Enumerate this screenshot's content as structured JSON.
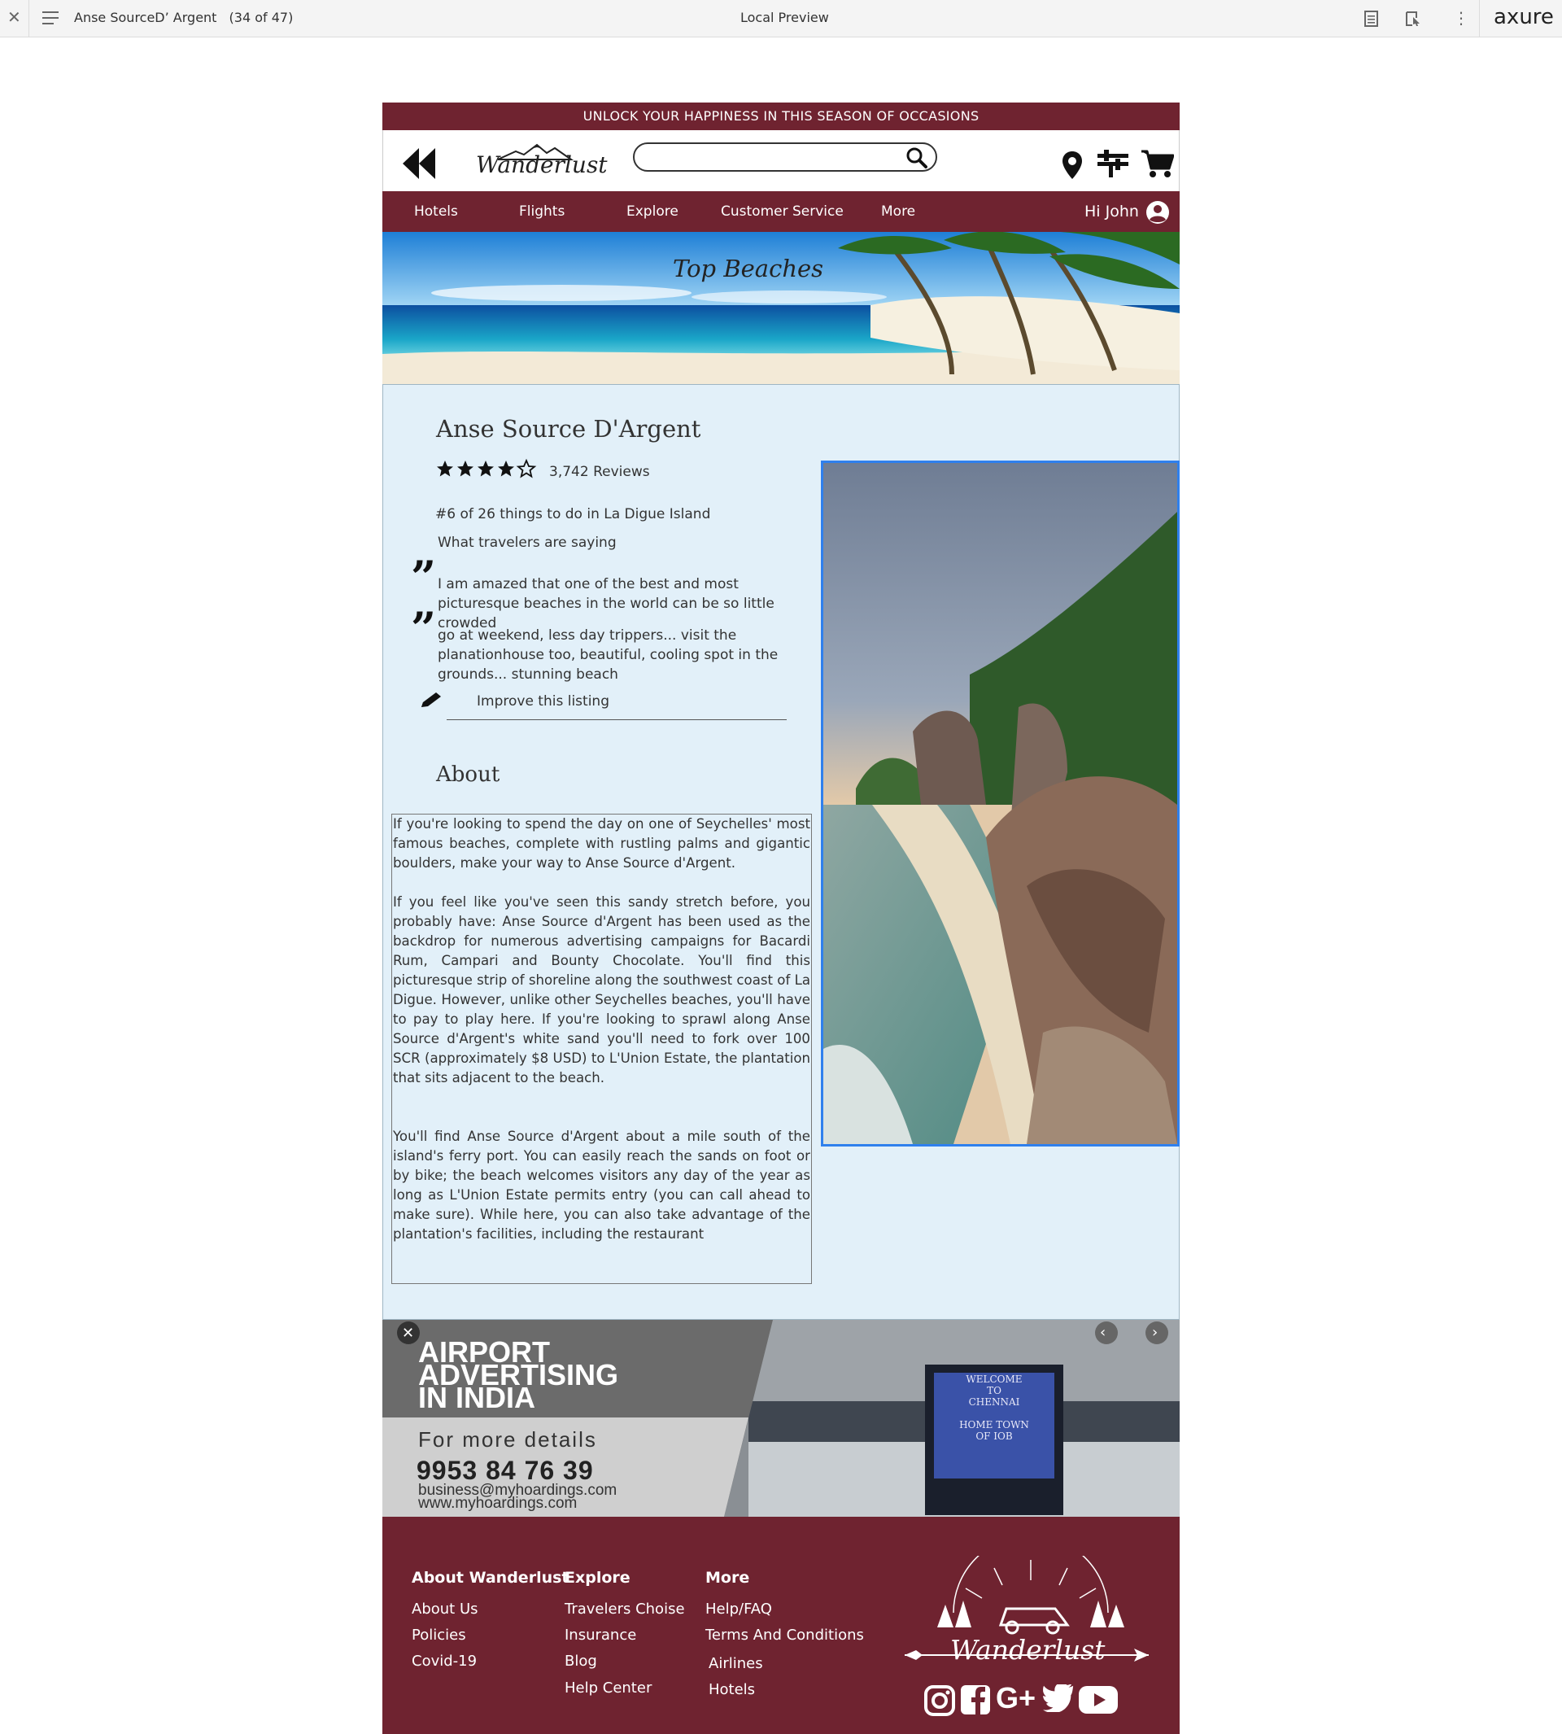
{
  "toolbar": {
    "page_name": "Anse SourceD’ Argent",
    "page_count": "(34 of 47)",
    "center_title": "Local Preview",
    "brand": "axure"
  },
  "promo": {
    "text": "UNLOCK YOUR HAPPINESS IN THIS SEASON OF OCCASIONS"
  },
  "header": {
    "logo": "Wanderlust",
    "search_placeholder": ""
  },
  "nav": {
    "items": [
      "Hotels",
      "Flights",
      "Explore",
      "Customer Service",
      "More"
    ],
    "greeting": "Hi John"
  },
  "banner": {
    "title": "Top Beaches"
  },
  "listing": {
    "name": "Anse Source D'Argent",
    "rating": 4.5,
    "reviews": "3,742 Reviews",
    "rank": "#6 of 26 things to do in La Digue Island",
    "travelers_heading": "What travelers are saying",
    "quotes": [
      "I am amazed that one of the best and most picturesque beaches in the world can be so little crowded",
      "go at weekend, less day trippers... visit the planationhouse too, beautiful, cooling spot in the grounds... stunning beach"
    ],
    "improve": "Improve this listing"
  },
  "about": {
    "heading": "About",
    "paragraphs": [
      "If you're looking to spend the day on one of Seychelles' most famous beaches, complete with rustling palms and gigantic boulders, make your way to Anse Source d'Argent.",
      "If you feel like you've seen this sandy stretch before, you probably have: Anse Source d'Argent has been used as the backdrop for numerous advertising campaigns for Bacardi Rum, Campari and Bounty Chocolate. You'll find this picturesque strip of shoreline along the southwest coast of La Digue. However, unlike other Seychelles beaches, you'll have to pay to play here. If you're looking to sprawl along Anse Source d'Argent's white sand you'll need to fork over 100 SCR (approximately $8 USD) to L'Union Estate, the plantation that sits adjacent to the beach.",
      "You'll find Anse Source d'Argent about a mile south of the island's ferry port. You can easily reach the sands on foot or by bike; the beach welcomes visitors any day of the year as long as L'Union Estate permits entry (you can call ahead to make sure). While here, you can also take advantage of the plantation's facilities, including the restaurant"
    ]
  },
  "ad": {
    "line1": "AIRPORT",
    "line2": "ADVERTISING",
    "line3": "IN INDIA",
    "details": "For more details",
    "phone": "9953 84 76 39",
    "email": "business@myhoardings.com",
    "web": "www.myhoardings.com",
    "screen_lines": [
      "WELCOME",
      "TO",
      "CHENNAI",
      "HOME TOWN",
      "OF IOB"
    ]
  },
  "footer": {
    "col1": {
      "heading": "About Wanderlust",
      "links": [
        "About Us",
        "Policies",
        "Covid-19"
      ]
    },
    "col2": {
      "heading": "Explore",
      "links": [
        "Travelers Choise",
        "Insurance",
        "Blog",
        "Help Center"
      ]
    },
    "col3": {
      "heading": "More",
      "links": [
        "Help/FAQ",
        "Terms And Conditions",
        "Airlines",
        "Hotels"
      ]
    },
    "logo": "Wanderlust"
  },
  "colors": {
    "maroon": "#6f2330",
    "content_bg": "#e2f0f9",
    "photo_border": "#2f80ed"
  }
}
